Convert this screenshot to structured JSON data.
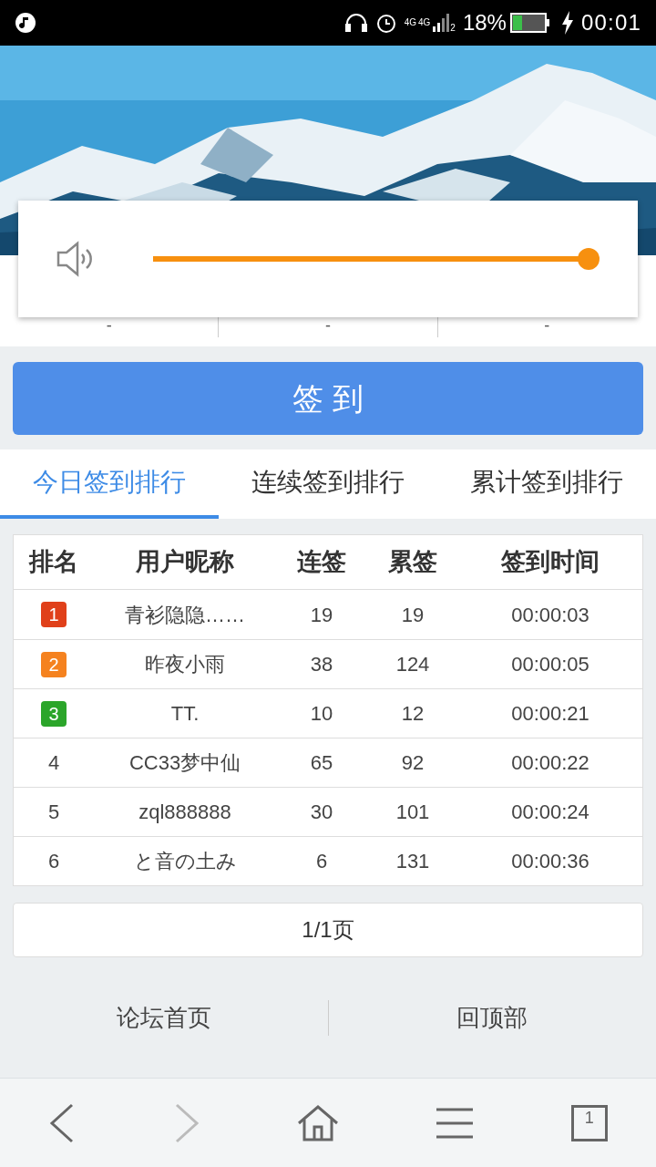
{
  "status_bar": {
    "network": [
      "4G",
      "4G"
    ],
    "sim": "2",
    "battery": "18%",
    "time": "00:01"
  },
  "volume": {
    "level": 1.0
  },
  "stats": [
    "-",
    "-",
    "-"
  ],
  "sign_button": "签 到",
  "tabs": [
    {
      "label": "今日签到排行",
      "selected": true
    },
    {
      "label": "连续签到排行",
      "selected": false
    },
    {
      "label": "累计签到排行",
      "selected": false
    }
  ],
  "table": {
    "columns": [
      "排名",
      "用户昵称",
      "连签",
      "累签",
      "签到时间"
    ],
    "rows": [
      {
        "rank": "1",
        "kind": "badge",
        "color": "#e0401a",
        "name": "青衫隐隐……",
        "streak": "19",
        "total": "19",
        "time": "00:00:03"
      },
      {
        "rank": "2",
        "kind": "badge",
        "color": "#f5821f",
        "name": "昨夜小雨",
        "streak": "38",
        "total": "124",
        "time": "00:00:05"
      },
      {
        "rank": "3",
        "kind": "badge",
        "color": "#2ba52a",
        "name": "TT.",
        "streak": "10",
        "total": "12",
        "time": "00:00:21"
      },
      {
        "rank": "4",
        "kind": "plain",
        "name": "CC33梦中仙",
        "streak": "65",
        "total": "92",
        "time": "00:00:22"
      },
      {
        "rank": "5",
        "kind": "plain",
        "name": "zql888888",
        "streak": "30",
        "total": "101",
        "time": "00:00:24"
      },
      {
        "rank": "6",
        "kind": "plain",
        "name": "と音の土み",
        "streak": "6",
        "total": "131",
        "time": "00:00:36"
      }
    ]
  },
  "pager": "1/1页",
  "footer_links": [
    "论坛首页",
    "回顶部"
  ],
  "browser_nav": {
    "back_disabled": false,
    "forward_disabled": true,
    "tabs_count": "1"
  }
}
